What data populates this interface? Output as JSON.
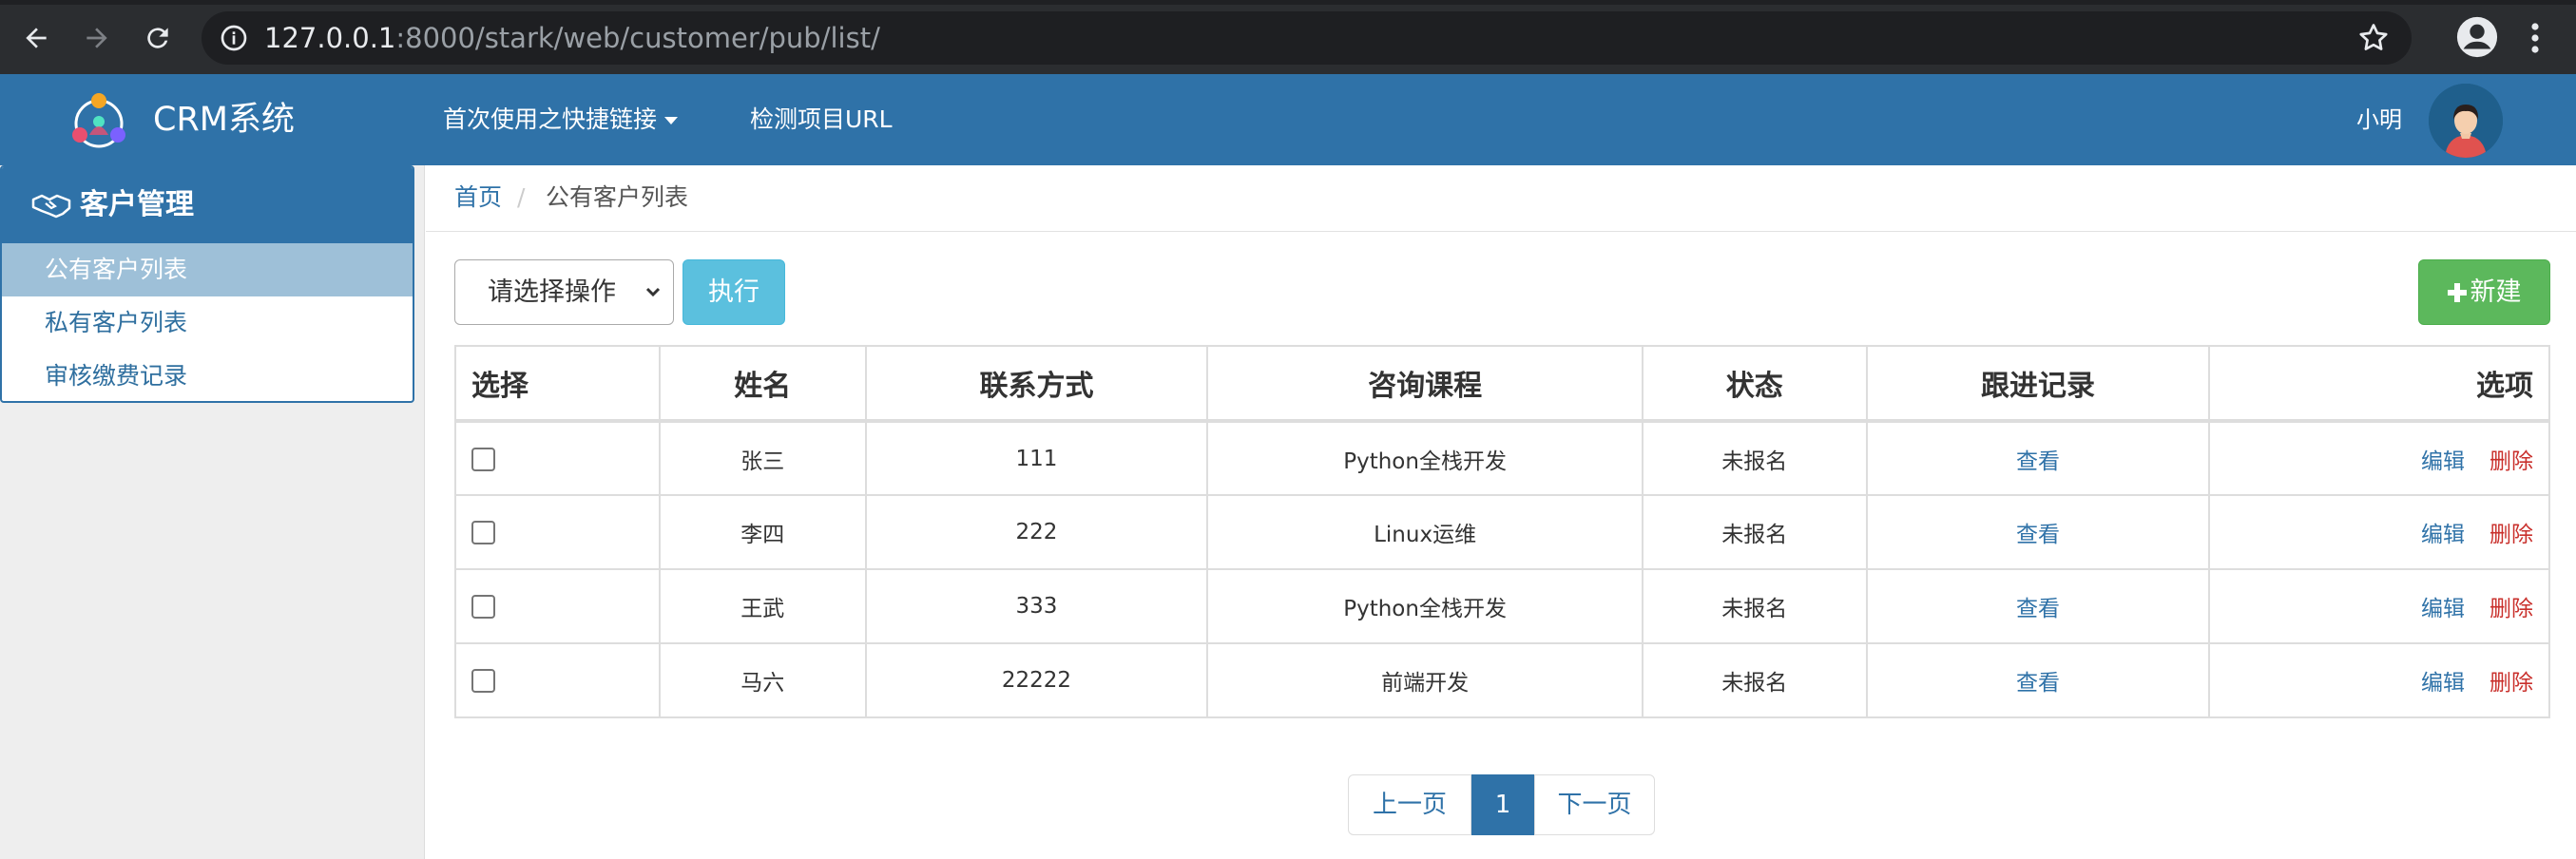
{
  "browser": {
    "url_host": "127.0.0.1",
    "url_rest": ":8000/stark/web/customer/pub/list/"
  },
  "header": {
    "brand": "CRM系统",
    "nav": [
      "首次使用之快捷链接",
      "检测项目URL"
    ],
    "username": "小明"
  },
  "sidebar": {
    "title": "客户管理",
    "items": [
      {
        "label": "公有客户列表",
        "active": true
      },
      {
        "label": "私有客户列表",
        "active": false
      },
      {
        "label": "审核缴费记录",
        "active": false
      }
    ]
  },
  "breadcrumb": {
    "home": "首页",
    "sep": "/",
    "current": "公有客户列表"
  },
  "toolbar": {
    "select_value": "请选择操作",
    "exec_label": "执行",
    "new_label": "新建"
  },
  "table": {
    "headers": [
      "选择",
      "姓名",
      "联系方式",
      "咨询课程",
      "状态",
      "跟进记录",
      "选项"
    ],
    "rows": [
      {
        "name": "张三",
        "contact": "111",
        "course": "Python全栈开发",
        "status": "未报名",
        "followup": "查看",
        "edit": "编辑",
        "delete": "删除"
      },
      {
        "name": "李四",
        "contact": "222",
        "course": "Linux运维",
        "status": "未报名",
        "followup": "查看",
        "edit": "编辑",
        "delete": "删除"
      },
      {
        "name": "王武",
        "contact": "333",
        "course": "Python全栈开发",
        "status": "未报名",
        "followup": "查看",
        "edit": "编辑",
        "delete": "删除"
      },
      {
        "name": "马六",
        "contact": "22222",
        "course": "前端开发",
        "status": "未报名",
        "followup": "查看",
        "edit": "编辑",
        "delete": "删除"
      }
    ]
  },
  "pagination": {
    "prev": "上一页",
    "current": "1",
    "next": "下一页"
  },
  "colors": {
    "primary": "#2f72a8",
    "info": "#5bc0de",
    "success": "#5cb85c",
    "danger": "#c9302c"
  }
}
